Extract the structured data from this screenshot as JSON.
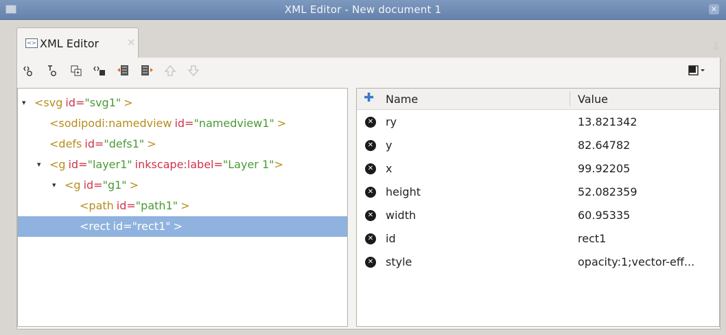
{
  "window": {
    "title": "XML Editor - New document 1"
  },
  "tab": {
    "label": "XML Editor",
    "close_glyph": "✕"
  },
  "toolbar": {
    "buttons": [
      {
        "name": "new-element-node-icon"
      },
      {
        "name": "new-text-node-icon"
      },
      {
        "name": "duplicate-node-icon"
      },
      {
        "name": "delete-node-icon"
      },
      {
        "name": "unindent-node-icon"
      },
      {
        "name": "indent-node-icon"
      },
      {
        "name": "raise-node-icon"
      },
      {
        "name": "lower-node-icon"
      }
    ]
  },
  "tree": {
    "nodes": [
      {
        "name": "<svg",
        "attr": "id=",
        "value": "\"svg1\"",
        "close": ">",
        "expanded": true
      },
      {
        "name": "<sodipodi:namedview",
        "attr": "id=",
        "value": "\"namedview1\"",
        "close": ">"
      },
      {
        "name": "<defs",
        "attr": "id=",
        "value": "\"defs1\"",
        "close": ">"
      },
      {
        "name": "<g",
        "attr": "id=",
        "value": "\"layer1\"",
        "attr2": "inkscape:label=",
        "value2": "\"Layer 1\"",
        "close": ">",
        "expanded": true
      },
      {
        "name": "<g",
        "attr": "id=",
        "value": "\"g1\"",
        "close": ">",
        "expanded": true
      },
      {
        "name": "<path",
        "attr": "id=",
        "value": "\"path1\"",
        "close": ">"
      },
      {
        "name": "<rect",
        "attr": "id=",
        "value": "\"rect1\"",
        "close": ">",
        "selected": true
      }
    ]
  },
  "attributes": {
    "header": {
      "name": "Name",
      "value": "Value"
    },
    "rows": [
      {
        "name": "ry",
        "value": "13.821342"
      },
      {
        "name": "y",
        "value": "82.64782"
      },
      {
        "name": "x",
        "value": "99.92205"
      },
      {
        "name": "height",
        "value": "52.082359"
      },
      {
        "name": "width",
        "value": "60.95335"
      },
      {
        "name": "id",
        "value": "rect1"
      },
      {
        "name": "style",
        "value": "opacity:1;vector-eff..."
      }
    ]
  }
}
